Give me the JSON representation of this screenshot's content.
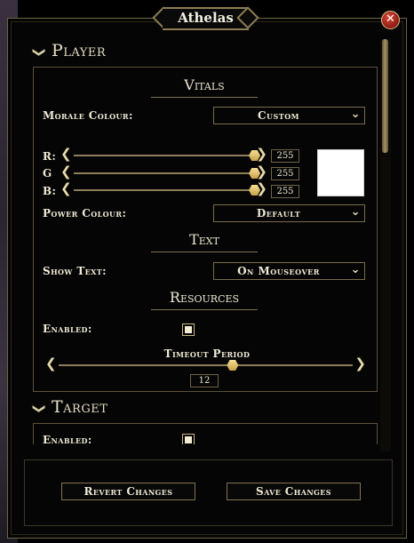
{
  "window": {
    "title": "Athelas",
    "close_icon": "close-icon"
  },
  "player": {
    "header": "Player",
    "vitals": {
      "title": "Vitals",
      "morale_label": "Morale Colour:",
      "morale_value": "Custom",
      "rgb": [
        {
          "label": "R:",
          "value": "255",
          "level": 1.0
        },
        {
          "label": "G",
          "value": "255",
          "level": 1.0
        },
        {
          "label": "B:",
          "value": "255",
          "level": 1.0
        }
      ],
      "swatch_color": "#ffffff",
      "power_label": "Power Colour:",
      "power_value": "Default"
    },
    "text": {
      "title": "Text",
      "show_label": "Show Text:",
      "show_value": "On Mouseover"
    },
    "resources": {
      "title": "Resources",
      "enabled_label": "Enabled:",
      "enabled": true,
      "timeout_label": "Timeout Period",
      "timeout_value": "12",
      "timeout_level": 0.59
    }
  },
  "target": {
    "header": "Target",
    "enabled_label": "Enabled:",
    "enabled": true
  },
  "footer": {
    "revert_label": "Revert Changes",
    "save_label": "Save Changes"
  },
  "colors": {
    "accent_gold": "#8c7d52",
    "knob": "#e8c86a",
    "close_red": "#b4291c"
  }
}
